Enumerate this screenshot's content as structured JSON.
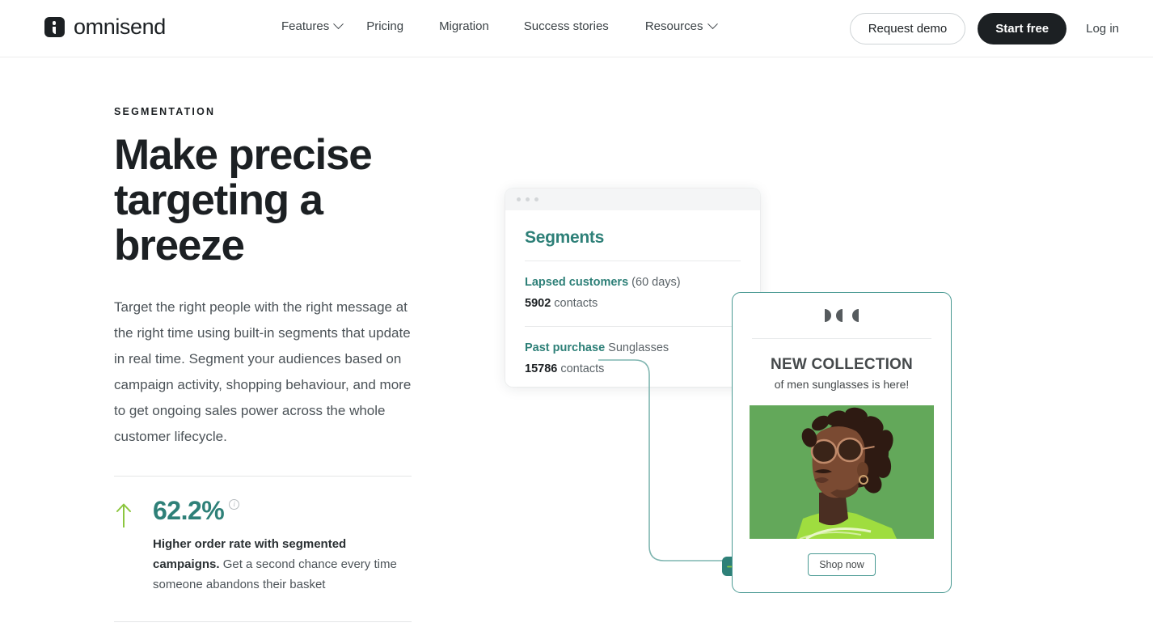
{
  "header": {
    "logo_text": "omnisend",
    "logo_icon": "omnisend-mark-icon",
    "nav": [
      {
        "label": "Features",
        "has_chevron": true
      },
      {
        "label": "Pricing",
        "has_chevron": false
      },
      {
        "label": "Migration",
        "has_chevron": false
      },
      {
        "label": "Success stories",
        "has_chevron": false
      },
      {
        "label": "Resources",
        "has_chevron": true
      }
    ],
    "request_demo_label": "Request demo",
    "start_free_label": "Start free",
    "login_label": "Log in"
  },
  "hero": {
    "eyebrow": "SEGMENTATION",
    "headline": "Make precise targeting a breeze",
    "body": "Target the right people with the right message at the right time using built-in segments that update in real time. Segment your audiences based on campaign activity, shopping behaviour, and more to get ongoing sales power across the whole customer lifecycle."
  },
  "stat": {
    "arrow_icon": "arrow-up-icon",
    "value": "62.2%",
    "info_icon": "info-circle-icon",
    "info_glyph": "i",
    "desc_bold": "Higher order rate with segmented campaigns.",
    "desc_rest": " Get a second chance every time someone abandons their basket"
  },
  "segments_card": {
    "title": "Segments",
    "items": [
      {
        "name": "Lapsed customers",
        "detail": "(60 days)",
        "count": "5902",
        "contacts_label": "contacts"
      },
      {
        "name": "Past purchase",
        "detail": "Sunglasses",
        "count": "15786",
        "contacts_label": "contacts"
      }
    ]
  },
  "email_card": {
    "logo_icon": "brand-half-circles-icon",
    "headline": "NEW COLLECTION",
    "subhead": "of men sunglasses is here!",
    "photo_alt": "man-with-sunglasses-photo",
    "cta_label": "Shop now"
  },
  "connector": {
    "arrow_icon": "arrow-right-icon"
  },
  "colors": {
    "teal": "#2e8078",
    "lime": "#8cc63f",
    "dark": "#1c2023",
    "body_gray": "#4c5358",
    "photo_green": "#63a85a"
  }
}
